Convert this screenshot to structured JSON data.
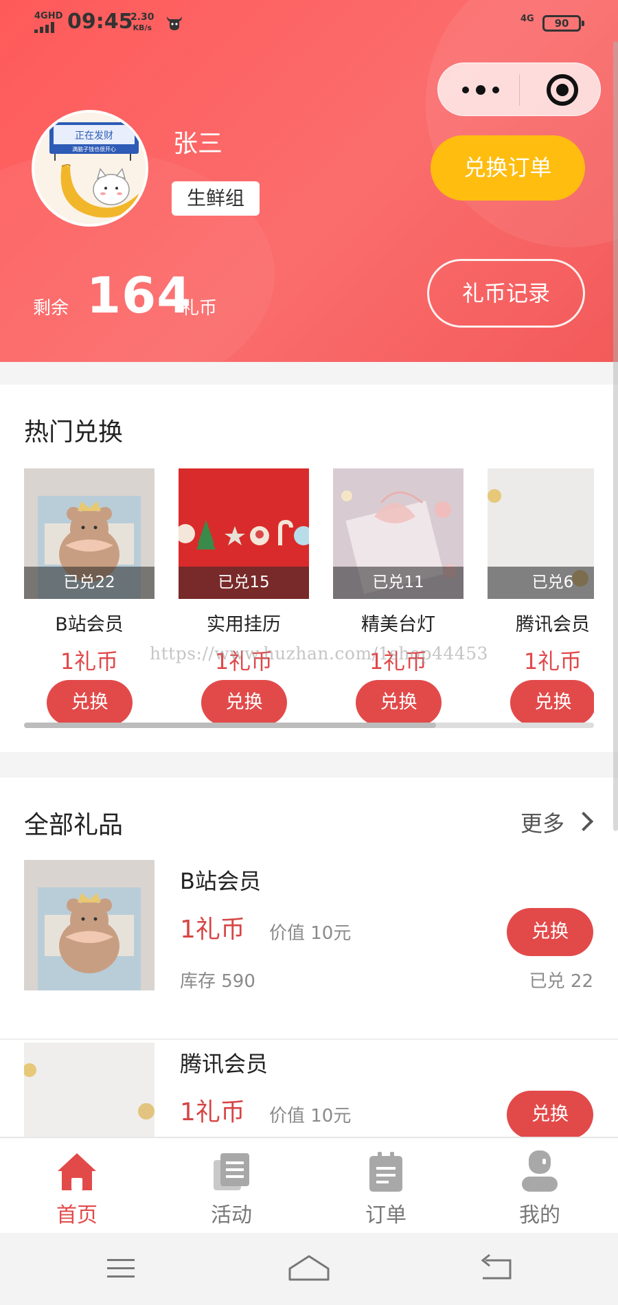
{
  "status_bar": {
    "network": "4GHD",
    "time": "09:45",
    "speed_value": "2.30",
    "speed_unit": "KB/s",
    "network_right": "4G",
    "battery": "90"
  },
  "profile": {
    "avatar_sign": "正在发财",
    "avatar_sign_sub": "满脑子钱也很开心",
    "name": "张三",
    "group": "生鲜组",
    "balance_prefix": "剩余",
    "balance": "164",
    "balance_unit": "礼币",
    "exchange_order_label": "兑换订单",
    "coin_record_label": "礼币记录"
  },
  "hot": {
    "title": "热门兑换",
    "items": [
      {
        "name": "B站会员",
        "badge": "已兑22",
        "price": "1礼币",
        "button": "兑换"
      },
      {
        "name": "实用挂历",
        "badge": "已兑15",
        "price": "1礼币",
        "button": "兑换"
      },
      {
        "name": "精美台灯",
        "badge": "已兑11",
        "price": "1礼币",
        "button": "兑换"
      },
      {
        "name": "腾讯会员",
        "badge": "已兑6",
        "price": "1礼币",
        "button": "兑换"
      }
    ]
  },
  "watermark": "https://www.huzhan.com/1shop44453",
  "all_gifts": {
    "title": "全部礼品",
    "more_label": "更多",
    "items": [
      {
        "name": "B站会员",
        "price": "1礼币",
        "value": "价值 10元",
        "stock": "库存 590",
        "redeemed": "已兑 22",
        "button": "兑换"
      },
      {
        "name": "腾讯会员",
        "price": "1礼币",
        "value": "价值 10元",
        "button": "兑换"
      }
    ]
  },
  "tabbar": {
    "items": [
      {
        "label": "首页",
        "icon": "home-icon",
        "active": true
      },
      {
        "label": "活动",
        "icon": "activity-icon",
        "active": false
      },
      {
        "label": "订单",
        "icon": "order-icon",
        "active": false
      },
      {
        "label": "我的",
        "icon": "profile-icon",
        "active": false
      }
    ]
  },
  "colors": {
    "header_red": "#fb6666",
    "accent_red": "#e24a4a",
    "order_button_yellow": "#ffbd10"
  }
}
